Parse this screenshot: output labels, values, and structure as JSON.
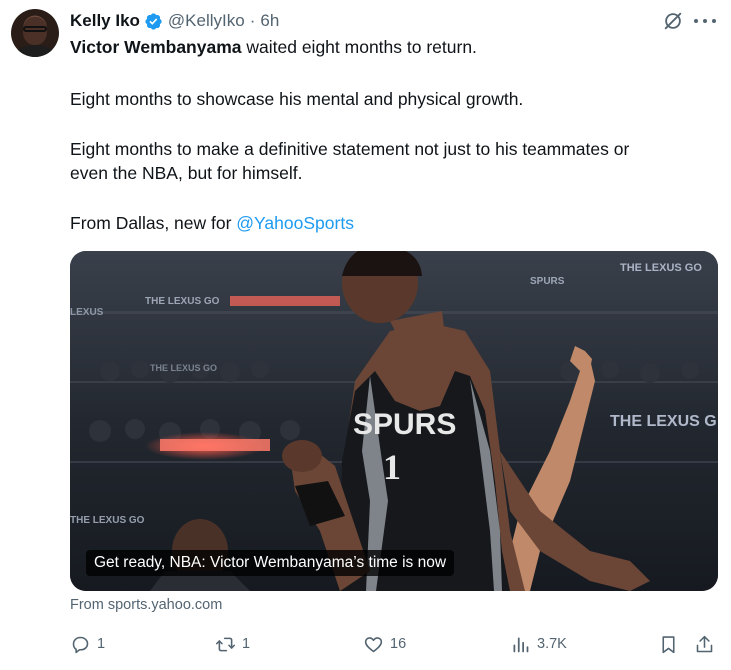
{
  "tweet": {
    "author": {
      "name": "Kelly Iko",
      "handle": "@KellyIko",
      "time": "6h",
      "separator": "·"
    },
    "body": {
      "line1_bold": "Victor Wembanyama",
      "line1_rest": " waited eight months to return.",
      "line2": "Eight months to showcase his mental and physical growth.",
      "line3a": "Eight months to make a definitive statement not just to his teammates or",
      "line3b": "even the NBA, but for himself.",
      "line4_prefix": "From Dallas, new for ",
      "line4_link": "@YahooSports"
    },
    "card": {
      "caption": "Get ready, NBA: Victor Wembanyama’s time is now",
      "jersey_team": "SPURS",
      "jersey_number": "1",
      "arena_signs": [
        "THE LEXUS GO",
        "THE LEXUS GO",
        "THE LEXUS GO"
      ],
      "source": "From sports.yahoo.com"
    },
    "actions": {
      "replies": "1",
      "reposts": "1",
      "likes": "16",
      "views": "3.7K"
    },
    "colors": {
      "verified": "#1d9bf0",
      "link": "#1d9bf0",
      "secondary_text": "#536471"
    }
  }
}
